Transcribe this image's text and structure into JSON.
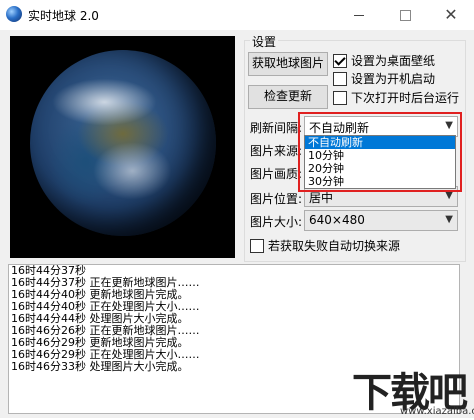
{
  "window": {
    "title": "实时地球 2.0",
    "minimize_symbol": "",
    "close_symbol": "✕"
  },
  "settings": {
    "group_title": "设置",
    "fetch_button": "获取地球图片",
    "update_button": "检查更新",
    "checkboxes": [
      {
        "label": "设置为桌面壁纸",
        "checked": true
      },
      {
        "label": "设置为开机启动",
        "checked": false
      },
      {
        "label": "下次打开时后台运行",
        "checked": false
      },
      {
        "label": "若获取失败自动切换来源",
        "checked": false
      }
    ],
    "labels": {
      "interval": "刷新间隔:",
      "source": "图片来源:",
      "quality": "图片画质:",
      "position": "图片位置:",
      "size": "图片大小:"
    },
    "interval": {
      "selected": "不自动刷新",
      "options": [
        "不自动刷新",
        "10分钟",
        "20分钟",
        "30分钟"
      ]
    },
    "position_value": "居中",
    "size_value": "640×480"
  },
  "log": [
    "16时44分37秒",
    "16时44分37秒  正在更新地球图片……",
    "16时44分40秒  更新地球图片完成。",
    "16时44分40秒  正在处理图片大小……",
    "16时44分44秒  处理图片大小完成。",
    "16时46分26秒  正在更新地球图片……",
    "16时46分29秒  更新地球图片完成。",
    "16时46分29秒  正在处理图片大小……",
    "16时46分33秒  处理图片大小完成。"
  ],
  "watermark": {
    "mark": "下载吧",
    "url": "www.xiazaiba.com"
  },
  "colors": {
    "selection": "#0078d7",
    "highlight_border": "#e02020"
  }
}
